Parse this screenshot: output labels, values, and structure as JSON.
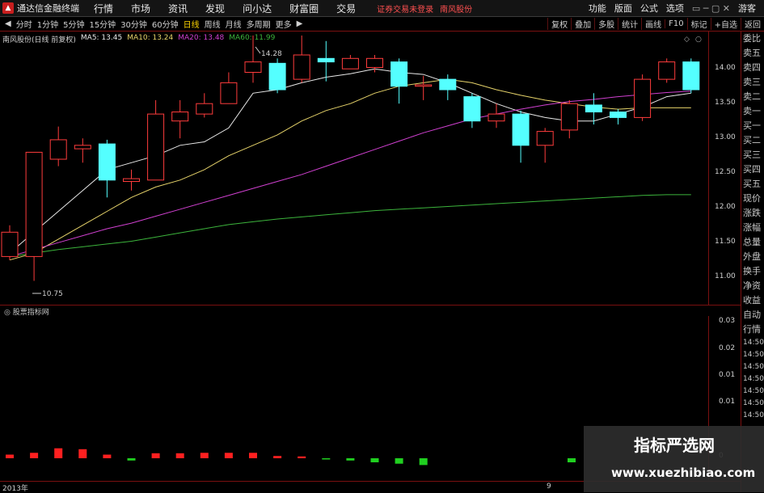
{
  "titlebar": {
    "app_name": "通达信金融终端",
    "menu": [
      "行情",
      "市场",
      "资讯",
      "发现",
      "问小达",
      "财富圈",
      "交易"
    ],
    "notice": "证券交易未登录",
    "stock_name": "南风股份",
    "right_menu": [
      "功能",
      "版面",
      "公式",
      "选项"
    ],
    "guest": "游客"
  },
  "toolbar": {
    "periods": [
      "分时",
      "1分钟",
      "5分钟",
      "15分钟",
      "30分钟",
      "60分钟",
      "日线",
      "周线",
      "月线",
      "多周期",
      "更多"
    ],
    "active": "日线",
    "right_buttons": [
      "复权",
      "叠加",
      "多股",
      "统计",
      "画线",
      "F10",
      "标记",
      "+自选",
      "返回"
    ]
  },
  "legend": {
    "title": "南风股份(日线 前复权)",
    "ma5": "MA5: 13.45",
    "ma10": "MA10: 13.24",
    "ma20": "MA20: 13.48",
    "ma60": "MA60: 11.99",
    "colors": {
      "ma5": "#e8e8e8",
      "ma10": "#e6d36a",
      "ma20": "#d040d0",
      "ma60": "#3cb43c"
    }
  },
  "annotations": {
    "high": "14.28",
    "low": "10.75"
  },
  "yaxis_ticks": [
    "14.00",
    "13.50",
    "13.00",
    "12.50",
    "12.00",
    "11.50",
    "11.00"
  ],
  "order_panel": [
    "委比",
    "卖五",
    "卖四",
    "卖三",
    "卖二",
    "卖一",
    "买一",
    "买二",
    "买三",
    "买四",
    "买五",
    "现价",
    "涨跌",
    "涨幅",
    "总量",
    "外盘",
    "换手",
    "净资",
    "收益",
    "自动",
    "行情",
    "14:50",
    "14:50",
    "14:50",
    "14:50",
    "14:50",
    "14:50",
    "14:50"
  ],
  "sub_indicator": {
    "title": "股票指标网",
    "ticks": [
      "0.03",
      "0.02",
      "0.01",
      "0.01",
      "0"
    ]
  },
  "dates": {
    "left": "2013年",
    "mid": "9"
  },
  "watermark": {
    "line1": "指标严选网",
    "line2": "www.xuezhibiao.com"
  },
  "chart_data": {
    "type": "candlestick",
    "title": "南风股份(日线 前复权)",
    "ylim": [
      10.75,
      14.35
    ],
    "up_color": "#ff3c3c",
    "down_color": "#54ffff",
    "candles": [
      {
        "o": 11.1,
        "c": 11.45,
        "h": 11.55,
        "l": 11.05
      },
      {
        "o": 11.1,
        "c": 12.6,
        "h": 12.6,
        "l": 10.75
      },
      {
        "o": 12.5,
        "c": 12.78,
        "h": 12.97,
        "l": 12.4
      },
      {
        "o": 12.65,
        "c": 12.7,
        "h": 12.8,
        "l": 12.45
      },
      {
        "o": 12.72,
        "c": 12.2,
        "h": 12.78,
        "l": 11.95
      },
      {
        "o": 12.18,
        "c": 12.22,
        "h": 12.35,
        "l": 12.05
      },
      {
        "o": 12.2,
        "c": 13.15,
        "h": 13.35,
        "l": 12.2
      },
      {
        "o": 13.05,
        "c": 13.18,
        "h": 13.35,
        "l": 12.8
      },
      {
        "o": 13.15,
        "c": 13.3,
        "h": 13.45,
        "l": 13.1
      },
      {
        "o": 13.3,
        "c": 13.6,
        "h": 13.75,
        "l": 13.3
      },
      {
        "o": 13.75,
        "c": 13.9,
        "h": 14.28,
        "l": 13.6
      },
      {
        "o": 13.88,
        "c": 13.5,
        "h": 13.95,
        "l": 13.45
      },
      {
        "o": 13.65,
        "c": 14.0,
        "h": 14.28,
        "l": 13.6
      },
      {
        "o": 13.95,
        "c": 13.9,
        "h": 14.2,
        "l": 13.62
      },
      {
        "o": 13.8,
        "c": 13.95,
        "h": 14.0,
        "l": 13.8
      },
      {
        "o": 13.82,
        "c": 13.95,
        "h": 14.0,
        "l": 13.75
      },
      {
        "o": 13.9,
        "c": 13.55,
        "h": 13.95,
        "l": 13.3
      },
      {
        "o": 13.55,
        "c": 13.57,
        "h": 13.7,
        "l": 13.35
      },
      {
        "o": 13.65,
        "c": 13.5,
        "h": 13.72,
        "l": 13.35
      },
      {
        "o": 13.4,
        "c": 13.05,
        "h": 13.45,
        "l": 12.95
      },
      {
        "o": 13.05,
        "c": 13.15,
        "h": 13.3,
        "l": 12.95
      },
      {
        "o": 13.15,
        "c": 12.7,
        "h": 13.2,
        "l": 12.45
      },
      {
        "o": 12.7,
        "c": 12.9,
        "h": 12.95,
        "l": 12.45
      },
      {
        "o": 12.92,
        "c": 13.3,
        "h": 13.35,
        "l": 12.8
      },
      {
        "o": 13.28,
        "c": 13.18,
        "h": 13.45,
        "l": 13.0
      },
      {
        "o": 13.18,
        "c": 13.1,
        "h": 13.22,
        "l": 13.0
      },
      {
        "o": 13.1,
        "c": 13.65,
        "h": 13.72,
        "l": 13.05
      },
      {
        "o": 13.65,
        "c": 13.9,
        "h": 13.95,
        "l": 13.6
      },
      {
        "o": 13.9,
        "c": 13.5,
        "h": 13.95,
        "l": 13.45
      }
    ],
    "ma": [
      {
        "name": "MA5",
        "color": "#e8e8e8",
        "values": [
          11.15,
          11.45,
          11.75,
          12.05,
          12.35,
          12.45,
          12.55,
          12.7,
          12.75,
          12.95,
          13.45,
          13.5,
          13.6,
          13.68,
          13.73,
          13.8,
          13.75,
          13.72,
          13.6,
          13.45,
          13.3,
          13.18,
          13.1,
          13.05,
          13.05,
          13.15,
          13.25,
          13.4,
          13.45
        ]
      },
      {
        "name": "MA10",
        "color": "#e6d36a",
        "values": [
          11.05,
          11.15,
          11.35,
          11.55,
          11.75,
          11.95,
          12.1,
          12.2,
          12.35,
          12.55,
          12.7,
          12.85,
          13.05,
          13.2,
          13.3,
          13.45,
          13.55,
          13.6,
          13.65,
          13.6,
          13.5,
          13.42,
          13.35,
          13.3,
          13.25,
          13.22,
          13.24,
          13.24,
          13.24
        ]
      },
      {
        "name": "MA20",
        "color": "#d040d0",
        "values": [
          11.1,
          11.2,
          11.3,
          11.4,
          11.5,
          11.58,
          11.68,
          11.78,
          11.88,
          11.98,
          12.08,
          12.18,
          12.28,
          12.4,
          12.52,
          12.64,
          12.76,
          12.88,
          12.98,
          13.08,
          13.15,
          13.22,
          13.28,
          13.33,
          13.36,
          13.4,
          13.43,
          13.46,
          13.48
        ]
      },
      {
        "name": "MA60",
        "color": "#3cb43c",
        "values": [
          11.1,
          11.15,
          11.2,
          11.24,
          11.28,
          11.32,
          11.38,
          11.44,
          11.5,
          11.56,
          11.6,
          11.64,
          11.67,
          11.7,
          11.73,
          11.76,
          11.78,
          11.8,
          11.82,
          11.84,
          11.86,
          11.88,
          11.9,
          11.92,
          11.94,
          11.96,
          11.98,
          11.99,
          11.99
        ]
      }
    ],
    "indicator": {
      "name": "股票指标网",
      "ylim": [
        -0.0015,
        0.035
      ],
      "values": [
        0.0008,
        0.0012,
        0.0022,
        0.002,
        0.0008,
        -0.0005,
        0.0011,
        0.0011,
        0.0012,
        0.0012,
        0.0012,
        0.0005,
        0.0004,
        -0.0001,
        -0.0005,
        -0.0009,
        -0.0012,
        -0.0015,
        null,
        null,
        null,
        null,
        null,
        null,
        null,
        null,
        null,
        null,
        null
      ],
      "last_value": -0.0009
    }
  }
}
